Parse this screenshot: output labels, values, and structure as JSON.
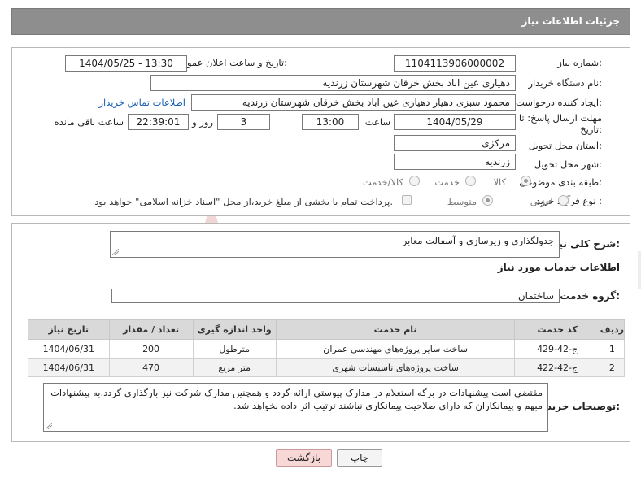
{
  "header": {
    "title": "جزئیات اطلاعات نیاز"
  },
  "form": {
    "need_number_label": "شماره نیاز:",
    "need_number": "1104113906000002",
    "announce_label": "تاریخ و ساعت اعلان عمومی:",
    "announce_value": "1404/05/25 - 13:30",
    "buyer_org_label": "نام دستگاه خریدار:",
    "buyer_org": "دهیاری عین اباد بخش خرقان شهرستان زرندیه",
    "creator_label": "ایجاد کننده درخواست:",
    "creator": "محمود سبزی دهیار دهیاری عین اباد بخش خرقان شهرستان زرندیه",
    "contact_link": "اطلاعات تماس خریدار",
    "deadline_label_1": "مهلت ارسال پاسخ: تا",
    "deadline_label_2": "تاریخ:",
    "deadline_date": "1404/05/29",
    "time_label": "ساعت",
    "deadline_time": "13:00",
    "days_value": "3",
    "days_label": "روز و",
    "remaining_time": "22:39:01",
    "remaining_label": "ساعت باقی مانده",
    "province_label": "استان محل تحویل:",
    "province": "مرکزی",
    "city_label": "شهر محل تحویل:",
    "city": "زرندیه",
    "category_label": "طبقه بندی موضوعی:",
    "category_options": [
      "کالا",
      "خدمت",
      "کالا/خدمت"
    ],
    "process_label": "نوع فرآیند خرید :",
    "process_options": [
      "جزیی",
      "متوسط"
    ],
    "payment_note": "پرداخت تمام یا بخشی از مبلغ خرید،از محل \"اسناد خزانه اسلامی\" خواهد بود."
  },
  "summary": {
    "label": "شرح کلی نیاز:",
    "value": "جدولگذاری و زیرسازی و آسفالت معابر"
  },
  "services": {
    "section_title": "اطلاعات خدمات مورد نیاز",
    "group_label": "گروه خدمت:",
    "group_value": "ساختمان",
    "columns": [
      "ردیف",
      "کد خدمت",
      "نام خدمت",
      "واحد اندازه گیری",
      "تعداد / مقدار",
      "تاریخ نیاز"
    ],
    "rows": [
      {
        "row": "1",
        "code": "ج-42-429",
        "name": "ساخت سایر پروژه‌های مهندسی عمران",
        "unit": "مترطول",
        "qty": "200",
        "date": "1404/06/31"
      },
      {
        "row": "2",
        "code": "ج-42-422",
        "name": "ساخت پروژه‌های تاسیسات شهری",
        "unit": "متر مربع",
        "qty": "470",
        "date": "1404/06/31"
      }
    ]
  },
  "buyer_notes": {
    "label": "توضیحات خریدار:",
    "value": "مقتضی است پیشنهادات در برگه استعلام در مدارک پیوستی ارائه گردد و همچنین مدارک شرکت نیز بارگذاری گردد.به پیشنهادات مبهم و پیمانکاران که دارای صلاحیت پیمانکاری نباشند ترتیب اثر داده نخواهد شد."
  },
  "buttons": {
    "print": "چاپ",
    "back": "بازگشت"
  },
  "colors": {
    "header_bg": "#8e8e8e",
    "link": "#1a5fb4",
    "back_btn_bg": "#f8d7d7",
    "watermark": "#f1d6d6"
  }
}
